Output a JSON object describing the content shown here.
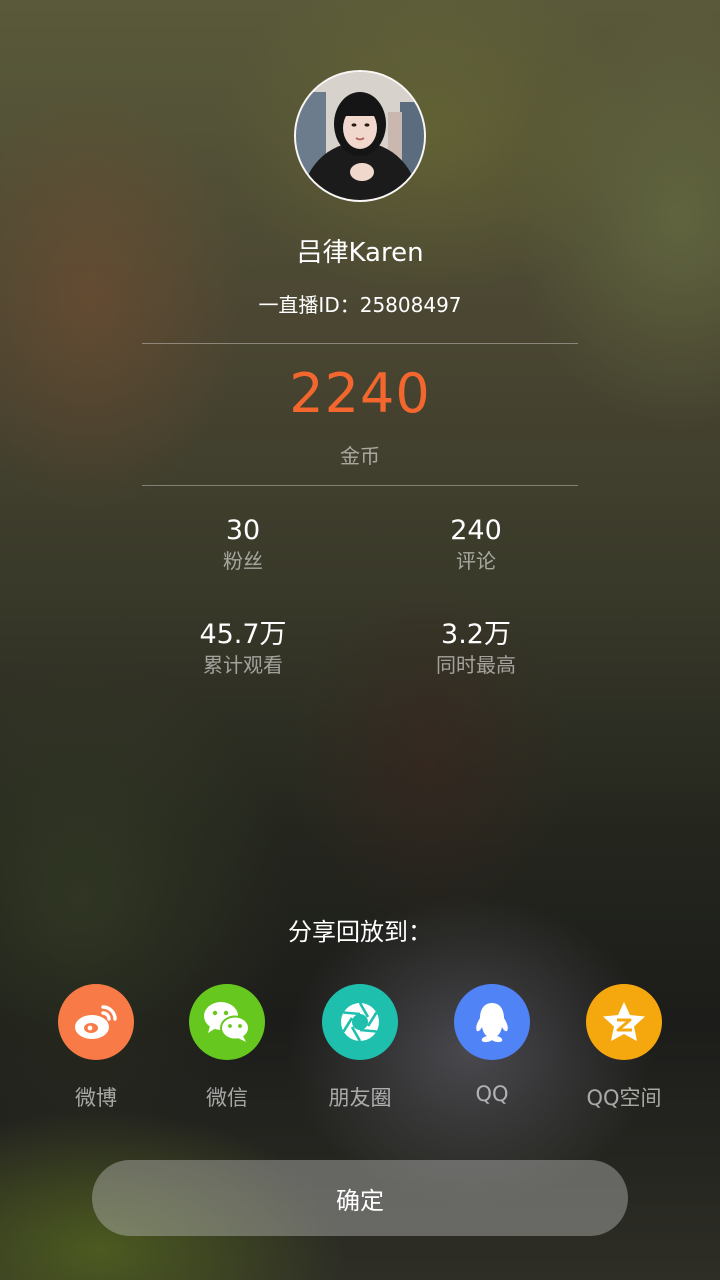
{
  "profile": {
    "name": "吕律Karen",
    "id_line": "一直播ID：25808497"
  },
  "coins": {
    "value": "2240",
    "label": "金币"
  },
  "stats": [
    {
      "value": "30",
      "label": "粉丝"
    },
    {
      "value": "240",
      "label": "评论"
    },
    {
      "value": "45.7万",
      "label": "累计观看"
    },
    {
      "value": "3.2万",
      "label": "同时最高"
    }
  ],
  "share": {
    "title": "分享回放到：",
    "items": [
      {
        "label": "微博",
        "icon": "weibo-icon",
        "color": "#f77a47"
      },
      {
        "label": "微信",
        "icon": "wechat-icon",
        "color": "#66c71e"
      },
      {
        "label": "朋友圈",
        "icon": "moments-icon",
        "color": "#1fbfae"
      },
      {
        "label": "QQ",
        "icon": "qq-icon",
        "color": "#4f83f6"
      },
      {
        "label": "QQ空间",
        "icon": "qzone-icon",
        "color": "#f5a70e"
      }
    ]
  },
  "confirm_label": "确定",
  "colors": {
    "accent": "#f3672e"
  }
}
